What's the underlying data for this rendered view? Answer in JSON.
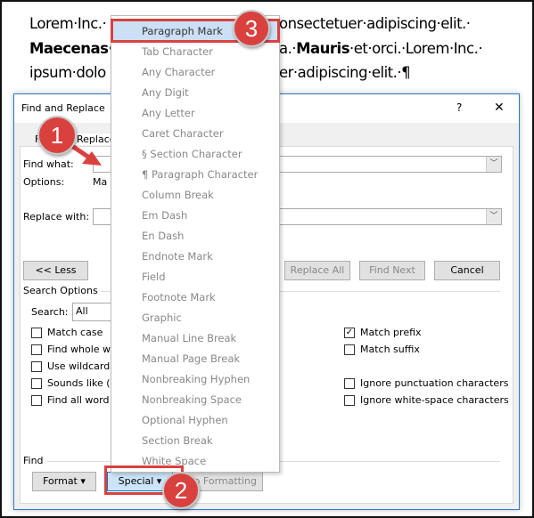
{
  "document": {
    "lines": [
      "Lorem·Inc.·…onsectetuer·adipiscing·elit.·",
      "Maecenas·…a.·Mauris·et·orci.·Lorem·Inc.·",
      "ipsum·dolo…er·adipiscing·elit.·¶"
    ],
    "line1_left": "Lorem·Inc.·",
    "line1_right": "onsectetuer·adipiscing·elit.·",
    "line2_left": "Maecenas·",
    "line2_mid": "a.·",
    "line2_bold": "Mauris",
    "line2_right": "·et·orci.·Lorem·Inc.·",
    "line3_left": "ipsum·dolo",
    "line3_right": "er·adipiscing·elit.·¶"
  },
  "dialog": {
    "title": "Find and Replace",
    "help": "?",
    "close": "✕",
    "tabs": [
      {
        "label": "Find"
      },
      {
        "label": "Replace"
      }
    ],
    "find_what_label": "Find what:",
    "find_what_value": "",
    "options_label": "Options:",
    "options_value": "Ma",
    "replace_with_label": "Replace with:",
    "replace_with_value": "",
    "buttons": {
      "less": "<< Less",
      "replace_all": "Replace All",
      "find_next": "Find Next",
      "cancel": "Cancel"
    },
    "search_options_label": "Search Options",
    "search_label": "Search:",
    "search_value": "All",
    "left_checks": [
      {
        "label": "Match case",
        "checked": false
      },
      {
        "label": "Find whole w",
        "checked": false
      },
      {
        "label": "Use wildcard",
        "checked": false
      },
      {
        "label": "Sounds like (",
        "checked": false
      },
      {
        "label": "Find all word",
        "checked": false
      }
    ],
    "right_checks": [
      {
        "label": "Match prefix",
        "checked": true
      },
      {
        "label": "Match suffix",
        "checked": false
      },
      {
        "label": "Ignore punctuation characters",
        "checked": false
      },
      {
        "label": "Ignore white-space characters",
        "checked": false
      }
    ],
    "find_section_label": "Find",
    "format_button": "Format ▾",
    "special_button": "Special ▾",
    "no_formatting_button": "No Formatting"
  },
  "special_menu": {
    "items": [
      "Paragraph Mark",
      "Tab Character",
      "Any Character",
      "Any Digit",
      "Any Letter",
      "Caret Character",
      "§ Section Character",
      "¶ Paragraph Character",
      "Column Break",
      "Em Dash",
      "En Dash",
      "Endnote Mark",
      "Field",
      "Footnote Mark",
      "Graphic",
      "Manual Line Break",
      "Manual Page Break",
      "Nonbreaking Hyphen",
      "Nonbreaking Space",
      "Optional Hyphen",
      "Section Break",
      "White Space"
    ],
    "highlighted": "Paragraph Mark"
  },
  "callouts": [
    "1",
    "2",
    "3"
  ],
  "colors": {
    "callout": "#d9413f",
    "highlight": "#cce0f5",
    "dialog_border": "#2b79d0"
  }
}
